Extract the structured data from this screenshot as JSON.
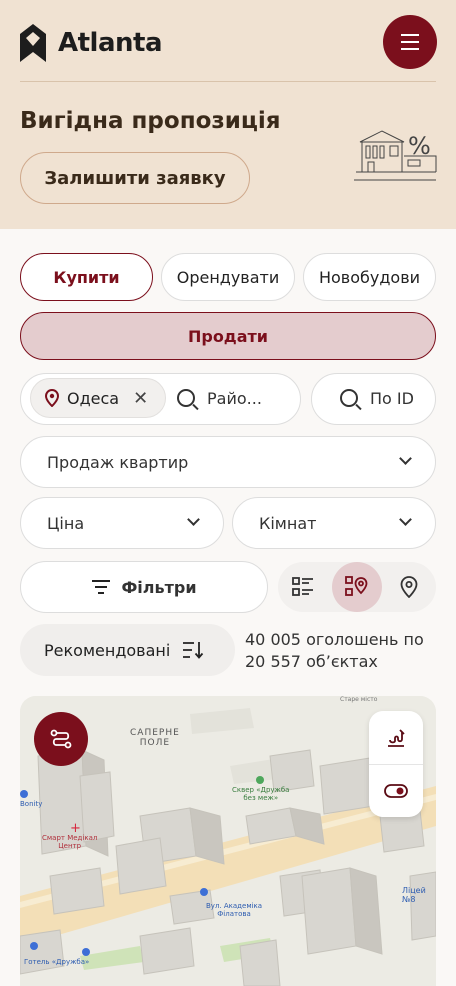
{
  "brand": {
    "name": "Atlanta"
  },
  "promo": {
    "title": "Вигідна пропозиція",
    "button": "Залишити заявку",
    "icon": "house-percent-illustration"
  },
  "deal_tabs": [
    {
      "label": "Купити",
      "active": true
    },
    {
      "label": "Орендувати",
      "active": false
    },
    {
      "label": "Новобудови",
      "active": false
    },
    {
      "label": "Продати",
      "active": false
    }
  ],
  "location": {
    "chip": "Одеса",
    "district_placeholder": "Райо...",
    "id_placeholder": "По ID"
  },
  "property_type": {
    "value": "Продаж квартир"
  },
  "price": {
    "label": "Ціна"
  },
  "rooms": {
    "label": "Кімнат"
  },
  "filters": {
    "label": "Фільтри"
  },
  "view_modes": [
    "list-icon",
    "map-list-icon",
    "map-pin-icon"
  ],
  "sort": {
    "label": "Рекомендовані"
  },
  "results": {
    "line1": "40 005 оголошень по",
    "line2": "20 557 об’єктах"
  },
  "map": {
    "labels": {
      "area": [
        "САПЕРНЕ",
        "ПОЛЕ"
      ],
      "square": [
        "Сквер «Дружба",
        "без меж»"
      ],
      "clinic": [
        "Смарт Медікал",
        "Центр"
      ],
      "street": [
        "Вул. Академіка",
        "Філатова"
      ],
      "hotel": "Готель «Дружба»",
      "lyceum": "Ліцей №8",
      "bonity": "Bonity",
      "corner": "Старе місто"
    },
    "colors": {
      "land": "#ecebe4",
      "road": "#f3dfb7",
      "green": "#cfe3b8",
      "building": "#d8d6d0"
    }
  },
  "colors": {
    "accent": "#7b0f1c",
    "header_bg": "#f0e2d2",
    "soft_accent": "#e4ccce"
  }
}
